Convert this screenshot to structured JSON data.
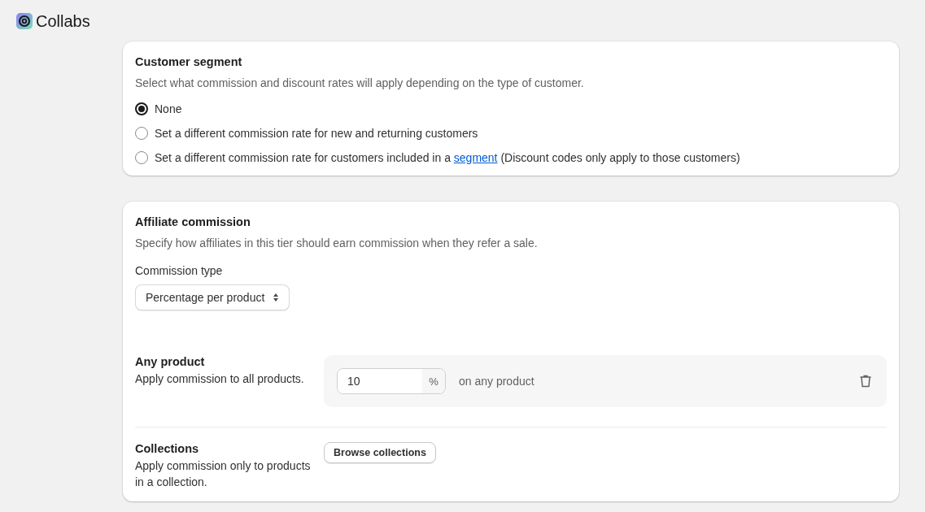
{
  "app": {
    "title": "Collabs"
  },
  "customer_segment": {
    "title": "Customer segment",
    "description": "Select what commission and discount rates will apply depending on the type of customer.",
    "options": [
      {
        "label": "None",
        "selected": true
      },
      {
        "label": "Set a different commission rate for new and returning customers",
        "selected": false
      },
      {
        "label": "Set a different commission rate for customers included in a ",
        "link": "segment",
        "after": " (Discount codes only apply to those customers)",
        "selected": false
      }
    ]
  },
  "affiliate_commission": {
    "title": "Affiliate commission",
    "description": "Specify how affiliates in this tier should earn commission when they refer a sale.",
    "commission_type": {
      "label": "Commission type",
      "value": "Percentage per product"
    },
    "rules": [
      {
        "kind": "rate",
        "title": "Any product",
        "description": "Apply commission to all products.",
        "value": "10",
        "unit": "%",
        "suffix": "on any product"
      },
      {
        "kind": "browse",
        "title": "Collections",
        "description": "Apply commission only to products in a collection.",
        "button": "Browse collections"
      }
    ]
  }
}
